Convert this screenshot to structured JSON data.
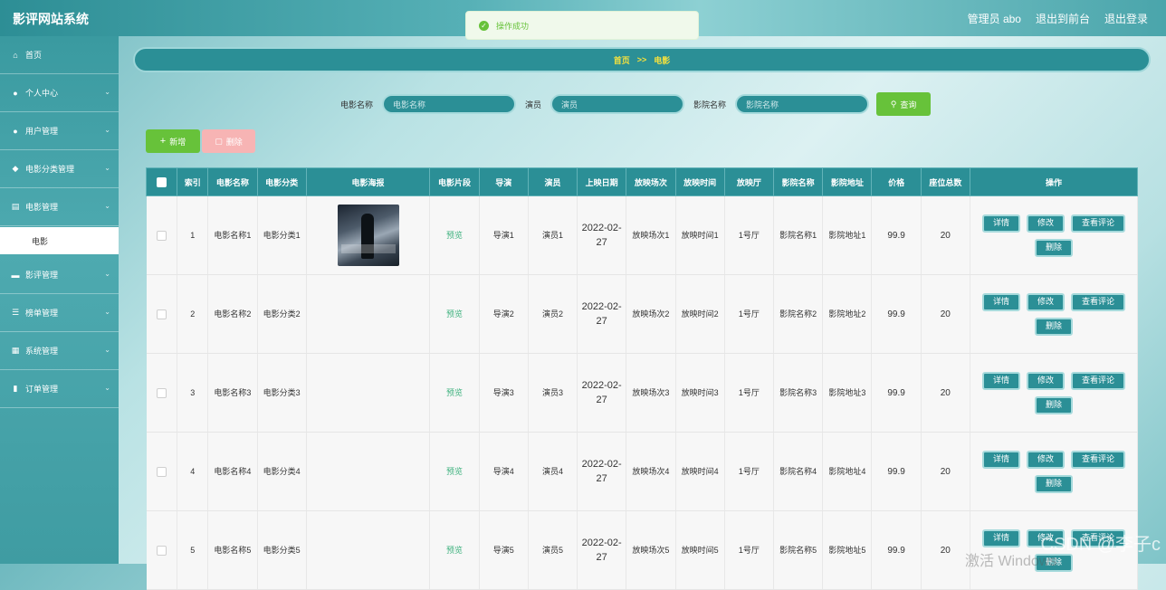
{
  "app": {
    "title": "影评网站系统"
  },
  "top_links": [
    "管理员 abo",
    "退出到前台",
    "退出登录"
  ],
  "toast": {
    "text": "操作成功"
  },
  "sidebar": {
    "items": [
      {
        "label": "首页",
        "icon": "home-icon",
        "expandable": false
      },
      {
        "label": "个人中心",
        "icon": "user-icon",
        "expandable": true
      },
      {
        "label": "用户管理",
        "icon": "user-icon",
        "expandable": true
      },
      {
        "label": "电影分类管理",
        "icon": "location-icon",
        "expandable": true
      },
      {
        "label": "电影管理",
        "icon": "printer-icon",
        "expandable": true
      }
    ],
    "sub_item": "电影",
    "items_after": [
      {
        "label": "影评管理",
        "icon": "card-icon",
        "expandable": true
      },
      {
        "label": "榜单管理",
        "icon": "list-icon",
        "expandable": true
      },
      {
        "label": "系统管理",
        "icon": "grid-icon",
        "expandable": true
      },
      {
        "label": "订单管理",
        "icon": "chart-icon",
        "expandable": true
      }
    ]
  },
  "breadcrumb": {
    "home": "首页",
    "sep": ">>",
    "current": "电影"
  },
  "search": {
    "movie_label": "电影名称",
    "movie_placeholder": "电影名称",
    "actor_label": "演员",
    "actor_placeholder": "演员",
    "cinema_label": "影院名称",
    "cinema_placeholder": "影院名称",
    "button": "查询"
  },
  "actions": {
    "add": "新增",
    "delete": "删除"
  },
  "table": {
    "headers": [
      "索引",
      "电影名称",
      "电影分类",
      "电影海报",
      "电影片段",
      "导演",
      "演员",
      "上映日期",
      "放映场次",
      "放映时间",
      "放映厅",
      "影院名称",
      "影院地址",
      "价格",
      "座位总数",
      "操作"
    ],
    "op_labels": {
      "detail": "详情",
      "edit": "修改",
      "comments": "查看评论",
      "delete": "删除"
    },
    "rows": [
      {
        "index": "1",
        "name": "电影名称1",
        "category": "电影分类1",
        "has_poster": true,
        "clip": "预览",
        "director": "导演1",
        "actor": "演员1",
        "date": "2022-02-27",
        "session": "放映场次1",
        "time": "放映时间1",
        "hall": "1号厅",
        "cinema": "影院名称1",
        "address": "影院地址1",
        "price": "99.9",
        "seats": "20"
      },
      {
        "index": "2",
        "name": "电影名称2",
        "category": "电影分类2",
        "has_poster": false,
        "clip": "预览",
        "director": "导演2",
        "actor": "演员2",
        "date": "2022-02-27",
        "session": "放映场次2",
        "time": "放映时间2",
        "hall": "1号厅",
        "cinema": "影院名称2",
        "address": "影院地址2",
        "price": "99.9",
        "seats": "20"
      },
      {
        "index": "3",
        "name": "电影名称3",
        "category": "电影分类3",
        "has_poster": false,
        "clip": "预览",
        "director": "导演3",
        "actor": "演员3",
        "date": "2022-02-27",
        "session": "放映场次3",
        "time": "放映时间3",
        "hall": "1号厅",
        "cinema": "影院名称3",
        "address": "影院地址3",
        "price": "99.9",
        "seats": "20"
      },
      {
        "index": "4",
        "name": "电影名称4",
        "category": "电影分类4",
        "has_poster": false,
        "clip": "预览",
        "director": "导演4",
        "actor": "演员4",
        "date": "2022-02-27",
        "session": "放映场次4",
        "time": "放映时间4",
        "hall": "1号厅",
        "cinema": "影院名称4",
        "address": "影院地址4",
        "price": "99.9",
        "seats": "20"
      },
      {
        "index": "5",
        "name": "电影名称5",
        "category": "电影分类5",
        "has_poster": false,
        "clip": "预览",
        "director": "导演5",
        "actor": "演员5",
        "date": "2022-02-27",
        "session": "放映场次5",
        "time": "放映时间5",
        "hall": "1号厅",
        "cinema": "影院名称5",
        "address": "影院地址5",
        "price": "99.9",
        "seats": "20"
      }
    ]
  },
  "overlay": {
    "watermark": "CSDN @李子c",
    "activate": "激活 Windows"
  },
  "colors": {
    "teal": "#2b8f96",
    "green": "#67c23a",
    "pink": "#f7b4b4",
    "gold": "#f5e13d"
  }
}
